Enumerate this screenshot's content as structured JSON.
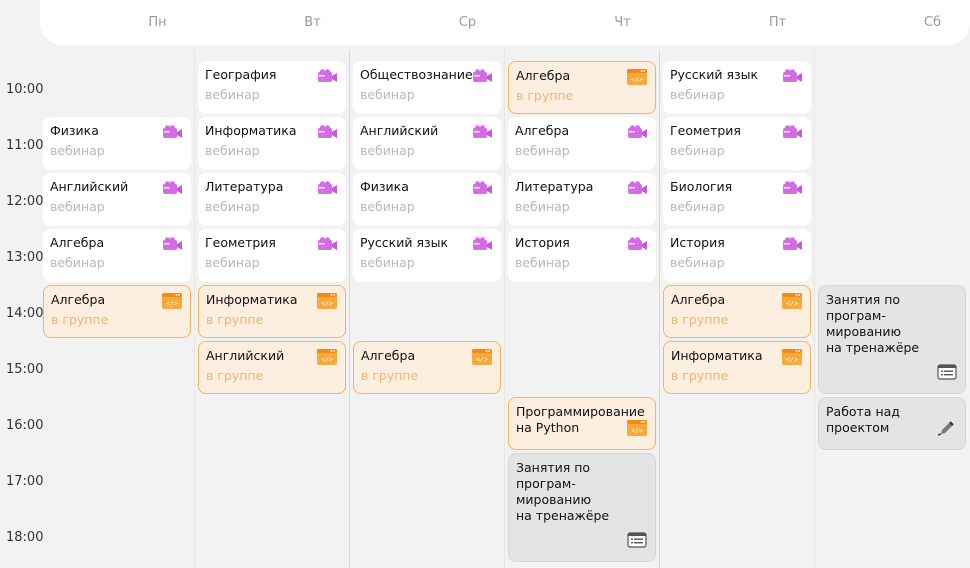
{
  "days": [
    "Пн",
    "Вт",
    "Ср",
    "Чт",
    "Пт",
    "Сб"
  ],
  "times": [
    "10:00",
    "11:00",
    "12:00",
    "13:00",
    "14:00",
    "15:00",
    "16:00",
    "17:00",
    "18:00"
  ],
  "icons": {
    "webinar": "video-camera-icon",
    "group": "code-window-icon",
    "trainer": "list-icon",
    "project": "pencil-icon"
  },
  "colors": {
    "accent": "#f7a93a",
    "webinar_icon": "#d46ce6",
    "group_bg": "#fdefdf",
    "card_border": "#f7b45a"
  },
  "lessons": [
    {
      "title": "Физика",
      "sub": "вебинар",
      "type": "web"
    },
    {
      "title": "Английский",
      "sub": "вебинар",
      "type": "web"
    },
    {
      "title": "Алгебра",
      "sub": "вебинар",
      "type": "web"
    },
    {
      "title": "Алгебра",
      "sub": "в группе",
      "type": "grp"
    },
    {
      "title": "География",
      "sub": "вебинар",
      "type": "web"
    },
    {
      "title": "Информатика",
      "sub": "вебинар",
      "type": "web"
    },
    {
      "title": "Литература",
      "sub": "вебинар",
      "type": "web"
    },
    {
      "title": "Геометрия",
      "sub": "вебинар",
      "type": "web"
    },
    {
      "title": "Информатика",
      "sub": "в группе",
      "type": "grp"
    },
    {
      "title": "Английский",
      "sub": "в группе",
      "type": "grp"
    },
    {
      "title": "Обществознание",
      "sub": "вебинар",
      "type": "web"
    },
    {
      "title": "Английский",
      "sub": "вебинар",
      "type": "web"
    },
    {
      "title": "Физика",
      "sub": "вебинар",
      "type": "web"
    },
    {
      "title": "Русский язык",
      "sub": "вебинар",
      "type": "web"
    },
    {
      "title": "Алгебра",
      "sub": "в группе",
      "type": "grp"
    },
    {
      "title": "Алгебра",
      "sub": "в группе",
      "type": "grp"
    },
    {
      "title": "Алгебра",
      "sub": "вебинар",
      "type": "web"
    },
    {
      "title": "Литература",
      "sub": "вебинар",
      "type": "web"
    },
    {
      "title": "История",
      "sub": "вебинар",
      "type": "web"
    },
    {
      "title": "Программирование на Python",
      "sub": "",
      "type": "grp"
    },
    {
      "title": "Занятия по програм-\nмированию\nна тренажёре",
      "sub": "",
      "type": "trainer"
    },
    {
      "title": "Русский язык",
      "sub": "вебинар",
      "type": "web"
    },
    {
      "title": "Геометрия",
      "sub": "вебинар",
      "type": "web"
    },
    {
      "title": "Биология",
      "sub": "вебинар",
      "type": "web"
    },
    {
      "title": "История",
      "sub": "вебинар",
      "type": "web"
    },
    {
      "title": "Алгебра",
      "sub": "в группе",
      "type": "grp"
    },
    {
      "title": "Информатика",
      "sub": "в группе",
      "type": "grp"
    },
    {
      "title": "Занятия по програм-\nмированию\nна тренажёре",
      "sub": "",
      "type": "trainer"
    },
    {
      "title": "Работа над проектом",
      "sub": "",
      "type": "project"
    }
  ]
}
